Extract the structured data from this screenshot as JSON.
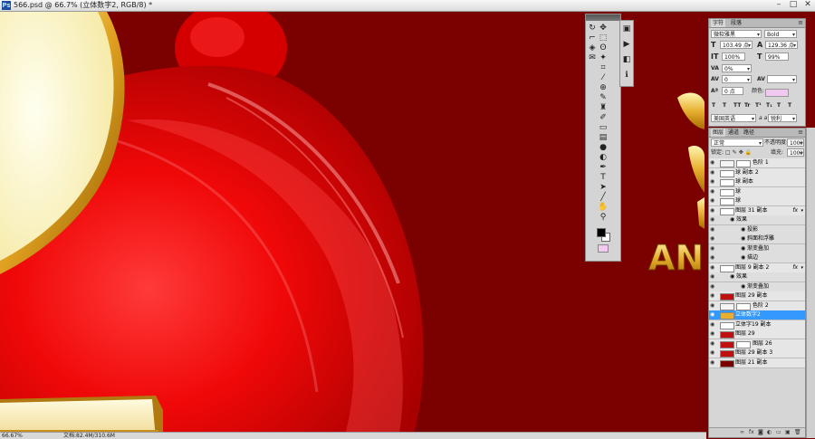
{
  "document": {
    "title": "566.psd @ 66.7% (立体数字2, RGB/8) *",
    "app_icon_text": "Ps"
  },
  "window_controls": [
    "–",
    "□",
    "✕"
  ],
  "canvas": {
    "text": "AN",
    "colors": {
      "background": "#7b0000",
      "gold": "#e2b23a",
      "pale_yellow": "#fffbd0"
    }
  },
  "tools_panel": {
    "tools": [
      {
        "name": "move-tool-icon",
        "glyph": "✥"
      },
      {
        "name": "marquee-tool-icon",
        "glyph": "⬚"
      },
      {
        "name": "lasso-tool-icon",
        "glyph": "ʘ"
      },
      {
        "name": "magic-wand-tool-icon",
        "glyph": "✦"
      },
      {
        "name": "crop-tool-icon",
        "glyph": "⌗"
      },
      {
        "name": "eyedropper-tool-icon",
        "glyph": "⁄"
      },
      {
        "name": "healing-tool-icon",
        "glyph": "⊕"
      },
      {
        "name": "brush-tool-icon",
        "glyph": "✎"
      },
      {
        "name": "stamp-tool-icon",
        "glyph": "♜"
      },
      {
        "name": "history-brush-tool-icon",
        "glyph": "✐"
      },
      {
        "name": "eraser-tool-icon",
        "glyph": "▭"
      },
      {
        "name": "gradient-tool-icon",
        "glyph": "▤"
      },
      {
        "name": "blur-tool-icon",
        "glyph": "●"
      },
      {
        "name": "dodge-tool-icon",
        "glyph": "◐"
      },
      {
        "name": "pen-tool-icon",
        "glyph": "✒"
      },
      {
        "name": "type-tool-icon",
        "glyph": "T"
      },
      {
        "name": "path-selection-tool-icon",
        "glyph": "➤"
      },
      {
        "name": "shape-tool-icon",
        "glyph": "╱"
      },
      {
        "name": "hand-tool-icon",
        "glyph": "✋"
      },
      {
        "name": "zoom-tool-icon",
        "glyph": "⚲"
      }
    ],
    "extra_tools": [
      {
        "name": "rotate-view-tool-icon",
        "glyph": "↻"
      },
      {
        "name": "ruler-tool-icon",
        "glyph": "⌐"
      },
      {
        "name": "3d-tool-icon",
        "glyph": "◈"
      },
      {
        "name": "note-tool-icon",
        "glyph": "✉"
      }
    ],
    "foreground_color": "#000000",
    "background_color": "#ffffff",
    "quickmask_color": "#f0c8f0"
  },
  "history_icons": [
    {
      "name": "history-panel-icon",
      "glyph": "▣"
    },
    {
      "name": "actions-panel-icon",
      "glyph": "▶"
    },
    {
      "name": "navigator-panel-icon",
      "glyph": "◧"
    },
    {
      "name": "info-panel-icon",
      "glyph": "ℹ"
    }
  ],
  "character_panel": {
    "tabs": [
      "字符",
      "段落"
    ],
    "font_family": "微软雅黑",
    "font_style": "Bold",
    "font_size": "103.49 点",
    "leading": "129.36 点",
    "vertical_scale": "100%",
    "horizontal_scale": "99%",
    "tracking": "0%",
    "kerning": "0",
    "baseline_shift": "0 点",
    "color_label": "颜色:",
    "text_color": "#f0c8f0",
    "language": "美国英语",
    "anti_alias": "锐利",
    "aa_icon": "a a",
    "style_buttons": [
      "T",
      "T",
      "TT",
      "Tr",
      "T¹",
      "T₁",
      "T",
      "T"
    ]
  },
  "layers_panel": {
    "tabs": [
      "图层",
      "通道",
      "路径"
    ],
    "blend_mode": "正常",
    "opacity_label": "不透明度:",
    "opacity": "100%",
    "lock_label": "锁定:",
    "fill_label": "填充:",
    "fill": "100%",
    "layers": [
      {
        "name": "色阶 1",
        "type": "adjustment",
        "fx": "",
        "eye": true,
        "selected": false
      },
      {
        "name": "球 副本 2",
        "type": "layer",
        "fx": "",
        "eye": true,
        "selected": false
      },
      {
        "name": "球 副本",
        "type": "layer",
        "fx": "",
        "eye": true,
        "selected": false
      },
      {
        "name": "球",
        "type": "layer",
        "fx": "",
        "eye": true,
        "selected": false
      },
      {
        "name": "球",
        "type": "layer",
        "fx": "",
        "eye": true,
        "selected": false
      },
      {
        "name": "图层 31 副本",
        "type": "layer",
        "fx": "fx",
        "eye": true,
        "selected": false
      },
      {
        "name": "效果",
        "type": "effect-group",
        "fx": "",
        "eye": true,
        "selected": false
      },
      {
        "name": "投影",
        "type": "effect",
        "fx": "",
        "eye": true,
        "selected": false
      },
      {
        "name": "斜面和浮雕",
        "type": "effect",
        "fx": "",
        "eye": true,
        "selected": false
      },
      {
        "name": "渐变叠加",
        "type": "effect",
        "fx": "",
        "eye": true,
        "selected": false
      },
      {
        "name": "描边",
        "type": "effect",
        "fx": "",
        "eye": true,
        "selected": false
      },
      {
        "name": "图层 9 副本 2",
        "type": "layer",
        "fx": "fx",
        "eye": true,
        "selected": false
      },
      {
        "name": "效果",
        "type": "effect-group",
        "fx": "",
        "eye": true,
        "selected": false
      },
      {
        "name": "渐变叠加",
        "type": "effect",
        "fx": "",
        "eye": true,
        "selected": false
      },
      {
        "name": "图层 29 副本",
        "type": "layer",
        "fx": "",
        "eye": true,
        "selected": false
      },
      {
        "name": "色阶 2",
        "type": "adjustment",
        "fx": "",
        "eye": true,
        "selected": false
      },
      {
        "name": "立体数字2",
        "type": "layer",
        "fx": "",
        "eye": true,
        "selected": true
      },
      {
        "name": "立体字19 副本",
        "type": "layer",
        "fx": "",
        "eye": true,
        "selected": false
      },
      {
        "name": "图层 29",
        "type": "layer",
        "fx": "",
        "eye": true,
        "selected": false
      },
      {
        "name": "图层 26",
        "type": "masked",
        "fx": "",
        "eye": true,
        "selected": false
      },
      {
        "name": "图层 29 副本 3",
        "type": "layer",
        "fx": "",
        "eye": true,
        "selected": false
      },
      {
        "name": "图层 21 副本",
        "type": "layer",
        "fx": "",
        "eye": true,
        "selected": false
      }
    ],
    "bottom_buttons": [
      {
        "name": "link-layers-icon",
        "glyph": "∞"
      },
      {
        "name": "add-style-icon",
        "glyph": "fx"
      },
      {
        "name": "add-mask-icon",
        "glyph": "◙"
      },
      {
        "name": "adjustment-layer-icon",
        "glyph": "◐"
      },
      {
        "name": "new-group-icon",
        "glyph": "▭"
      },
      {
        "name": "new-layer-icon",
        "glyph": "▣"
      },
      {
        "name": "delete-layer-icon",
        "glyph": "🗑"
      }
    ]
  },
  "status": {
    "zoom": "66.67%",
    "doc_info": "文档:82.4M/310.6M"
  }
}
